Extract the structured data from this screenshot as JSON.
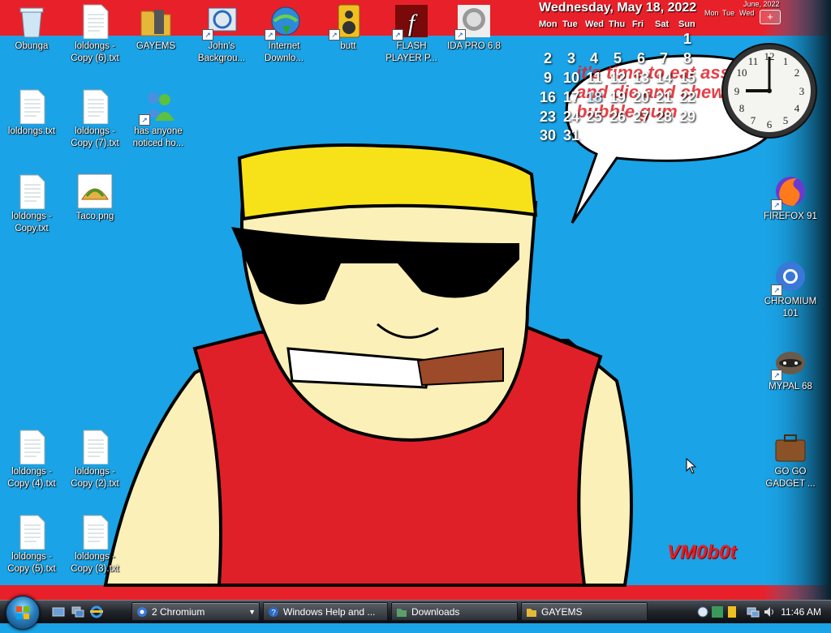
{
  "desktop": {
    "icons": [
      {
        "label": "Obunga",
        "icon": "recycle-bin-icon"
      },
      {
        "label": "loldongs - Copy (6).txt",
        "icon": "text-file-icon"
      },
      {
        "label": "GAYEMS",
        "icon": "folder-icon"
      },
      {
        "label": "John's Backgrou...",
        "icon": "background-app-icon"
      },
      {
        "label": "Internet Downlo...",
        "icon": "download-manager-icon"
      },
      {
        "label": "butt",
        "icon": "speaker-icon"
      },
      {
        "label": "FLASH PLAYER P...",
        "icon": "flash-icon"
      },
      {
        "label": "IDA PRO 6.8",
        "icon": "ida-icon"
      },
      {
        "label": "loldongs.txt",
        "icon": "text-file-icon"
      },
      {
        "label": "loldongs - Copy (7).txt",
        "icon": "text-file-icon"
      },
      {
        "label": "has anyone noticed ho...",
        "icon": "messenger-icon"
      },
      {
        "label": "loldongs - Copy.txt",
        "icon": "text-file-icon"
      },
      {
        "label": "Taco.png",
        "icon": "taco-image-icon"
      },
      {
        "label": "loldongs - Copy (4).txt",
        "icon": "text-file-icon"
      },
      {
        "label": "loldongs - Copy (2).txt",
        "icon": "text-file-icon"
      },
      {
        "label": "loldongs - Copy (5).txt",
        "icon": "text-file-icon"
      },
      {
        "label": "loldongs - Copy (3).txt",
        "icon": "text-file-icon"
      },
      {
        "label": "FIREFOX 91",
        "icon": "firefox-icon"
      },
      {
        "label": "CHROMIUM 101",
        "icon": "chromium-icon"
      },
      {
        "label": "MYPAL 68",
        "icon": "mypal-icon"
      },
      {
        "label": "GO GO GADGET ...",
        "icon": "briefcase-icon"
      }
    ],
    "speech_bubble": "it's time to eat ass and die and chew bubble gum",
    "signature": "VM0b0t"
  },
  "calendar": {
    "header": "Wednesday, May 18, 2022",
    "dow": [
      "Mon",
      "Tue",
      "Wed",
      "Thu",
      "Fri",
      "Sat",
      "Sun"
    ],
    "days": [
      "1",
      "2",
      "3",
      "4",
      "5",
      "6",
      "7",
      "8",
      "9",
      "10",
      "11",
      "12",
      "13",
      "14",
      "15",
      "16",
      "17",
      "18",
      "19",
      "20",
      "21",
      "22",
      "23",
      "24",
      "25",
      "26",
      "27",
      "28",
      "29",
      "30",
      "31"
    ],
    "mini_month": "June, 2022",
    "mini_dow": [
      "Mon",
      "Tue",
      "Wed"
    ],
    "add_label": "+"
  },
  "clock_gadget": {
    "time": "9:00"
  },
  "taskbar": {
    "tasks": [
      {
        "label": "2 Chromium"
      },
      {
        "label": "Windows Help and ..."
      },
      {
        "label": "Downloads"
      },
      {
        "label": "GAYEMS"
      }
    ],
    "clock": "11:46 AM"
  }
}
